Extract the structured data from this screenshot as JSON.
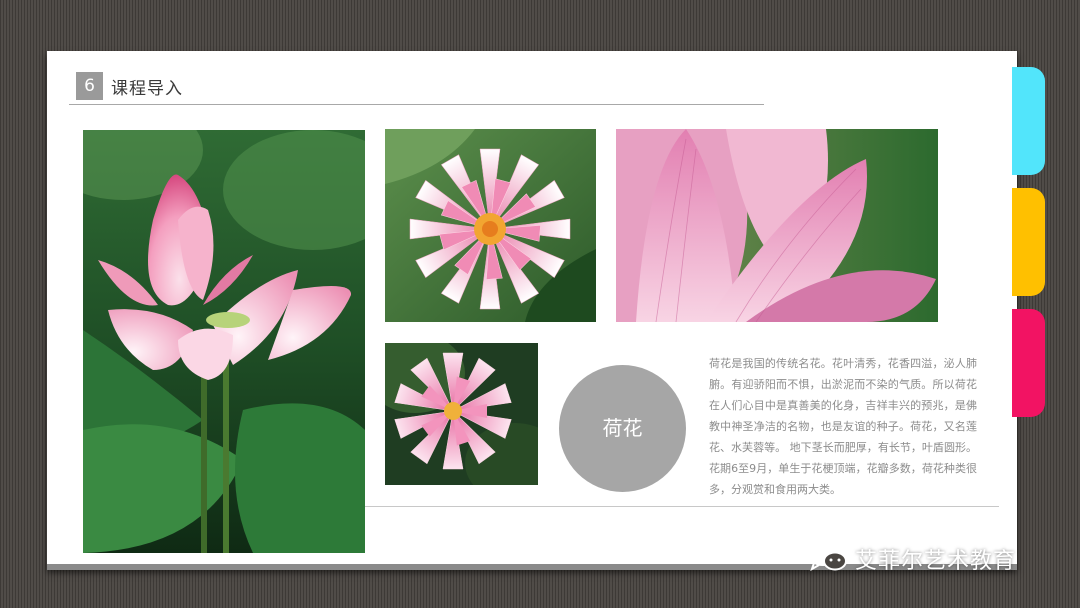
{
  "header": {
    "number": "6",
    "title": "课程导入"
  },
  "images": [
    {
      "name": "lotus-bud-and-bloom-photo",
      "subject": "lotus bud and open lotus"
    },
    {
      "name": "water-lily-top-view-photo",
      "subject": "pink water lily"
    },
    {
      "name": "lotus-petal-closeup-photo",
      "subject": "lotus petals close-up"
    },
    {
      "name": "pink-lotus-flower-photo",
      "subject": "pink lotus flower"
    }
  ],
  "badge": {
    "label": "荷花"
  },
  "description": "荷花是我国的传统名花。花叶清秀，花香四溢，泌人肺腑。有迎骄阳而不惧，出淤泥而不染的气质。所以荷花在人们心目中是真善美的化身，吉祥丰兴的预兆，是佛教中神圣净洁的名物，也是友谊的种子。荷花，又名莲花、水芙蓉等。 地下茎长而肥厚，有长节，叶盾圆形。花期6至9月，单生于花梗顶端，花瓣多数，荷花种类很多，分观赏和食用两大类。",
  "watermark": {
    "brand": "艾菲尔艺术教育",
    "icon": "wechat-icon"
  },
  "colors": {
    "tab_cyan": "#52e5fb",
    "tab_yellow": "#ffc000",
    "tab_pink": "#f21363",
    "badge": "#a6a6a6"
  }
}
